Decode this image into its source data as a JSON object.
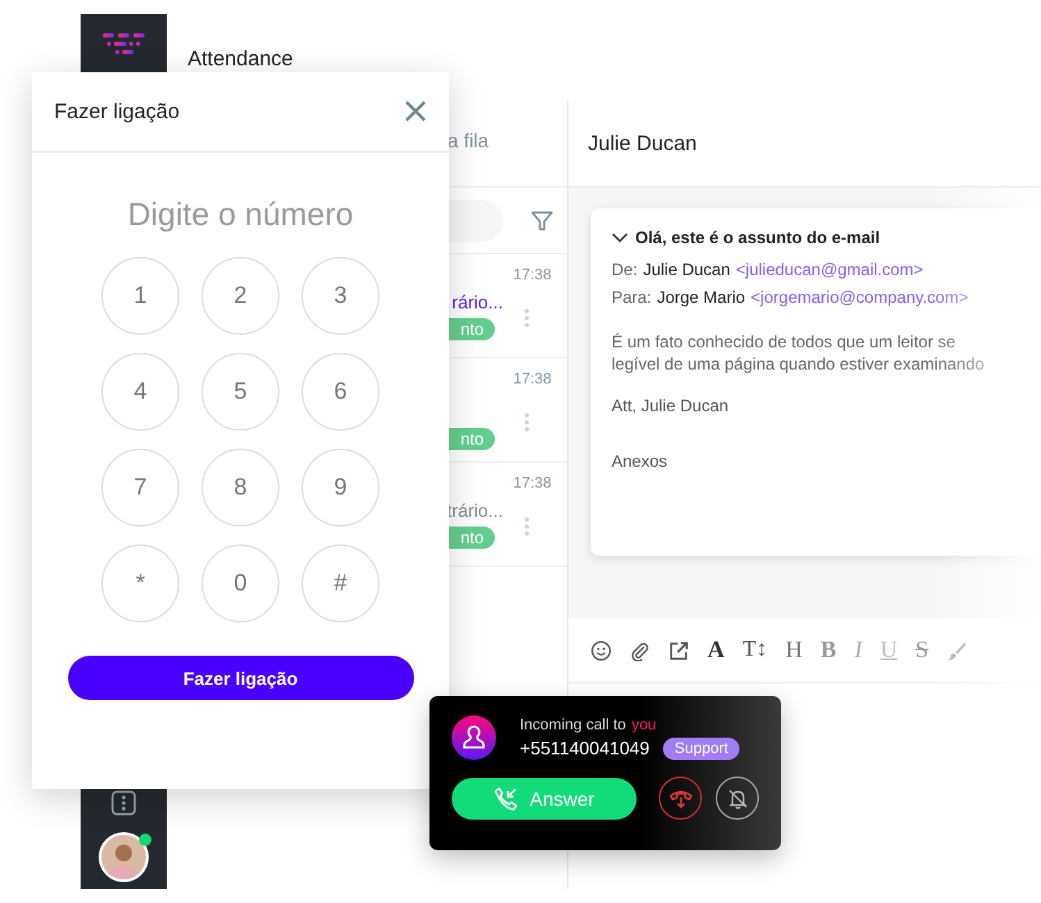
{
  "app": {
    "title": "Attendance"
  },
  "queue": {
    "tab": "a fila",
    "rows": [
      {
        "time": "17:38",
        "preview": "rário...",
        "unread": true,
        "tag": "nto"
      },
      {
        "time": "17:38",
        "tag": "nto"
      },
      {
        "time": "17:38",
        "preview": "trário...",
        "unread": false,
        "tag": "nto"
      }
    ]
  },
  "conversation": {
    "contact": "Julie Ducan",
    "email": {
      "subject": "Olá, este é o assunto do e-mail",
      "from_label": "De:",
      "from_name": "Julie Ducan",
      "from_address": "<julieducan@gmail.com>",
      "to_label": "Para:",
      "to_name": "Jorge Mario",
      "to_address": "<jorgemario@company.com>",
      "body": [
        "É um fato conhecido de todos que um leitor se",
        "legível de uma página quando estiver examinando"
      ],
      "signature": "Att, Julie Ducan",
      "attachments_label": "Anexos"
    },
    "toolbar": [
      {
        "kind": "emoji"
      },
      {
        "kind": "attach"
      },
      {
        "kind": "link"
      },
      {
        "kind": "font",
        "label": "A"
      },
      {
        "kind": "size",
        "label": "T↕"
      },
      {
        "kind": "heading",
        "label": "H"
      },
      {
        "kind": "bold",
        "label": "B"
      },
      {
        "kind": "italic",
        "label": "I"
      },
      {
        "kind": "underline",
        "label": "U"
      },
      {
        "kind": "strike",
        "label": "S"
      },
      {
        "kind": "brush"
      }
    ]
  },
  "dialer": {
    "title": "Fazer ligação",
    "placeholder": "Digite o número",
    "keys": [
      "1",
      "2",
      "3",
      "4",
      "5",
      "6",
      "7",
      "8",
      "9",
      "*",
      "0",
      "#"
    ],
    "call_button": "Fazer ligação"
  },
  "incoming_call": {
    "text": "Incoming call to",
    "highlight": "you",
    "number": "+551140041049",
    "tag": "Support",
    "answer": "Answer"
  }
}
